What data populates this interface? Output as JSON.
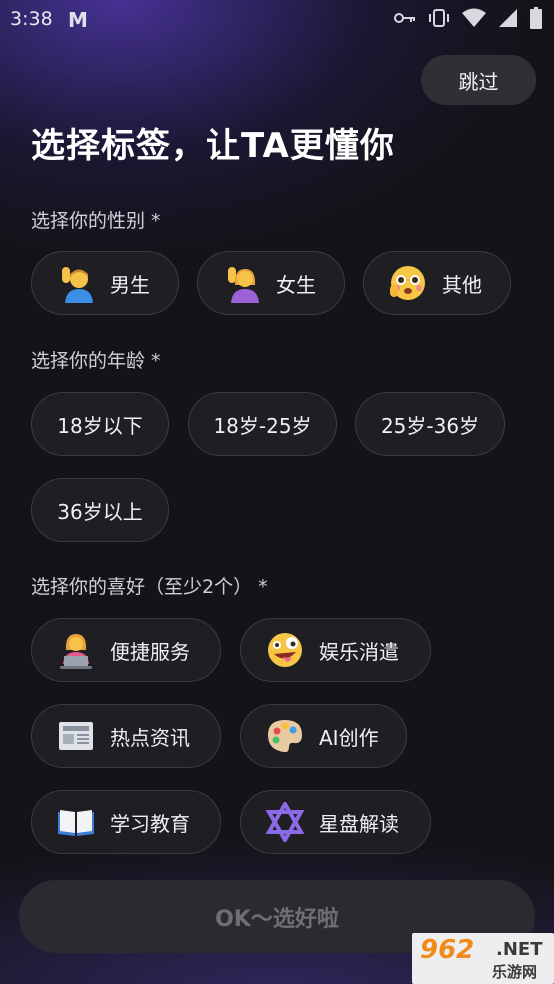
{
  "status_bar": {
    "time": "3:38",
    "mail_glyph": "M",
    "icons": [
      "key-icon",
      "vibrate-icon",
      "wifi-icon",
      "signal-icon",
      "battery-icon"
    ]
  },
  "skip_label": "跳过",
  "title": "选择标签，让TA更懂你",
  "gender": {
    "label": "选择你的性别 *",
    "options": [
      {
        "label": "男生",
        "icon": "man-raising-hand-icon"
      },
      {
        "label": "女生",
        "icon": "woman-raising-hand-icon"
      },
      {
        "label": "其他",
        "icon": "flushed-face-icon"
      }
    ]
  },
  "age": {
    "label": "选择你的年龄 *",
    "options": [
      "18岁以下",
      "18岁-25岁",
      "25岁-36岁",
      "36岁以上"
    ]
  },
  "interests": {
    "label": "选择你的喜好（至少2个） *",
    "options": [
      {
        "label": "便捷服务",
        "icon": "person-laptop-icon"
      },
      {
        "label": "娱乐消遣",
        "icon": "zany-face-icon"
      },
      {
        "label": "热点资讯",
        "icon": "newspaper-icon"
      },
      {
        "label": "AI创作",
        "icon": "palette-icon"
      },
      {
        "label": "学习教育",
        "icon": "open-book-icon"
      },
      {
        "label": "星盘解读",
        "icon": "star-of-david-icon"
      }
    ]
  },
  "ok_label": "OK～选好啦",
  "watermark": {
    "number": "962",
    "net": ".NET",
    "site": "乐游网"
  },
  "colors": {
    "background": "#141318",
    "chip_bg": "#1e1e23",
    "chip_border": "#3a3a42",
    "accent_glow": "#4e37aa",
    "disabled_text": "#6e6e76"
  }
}
